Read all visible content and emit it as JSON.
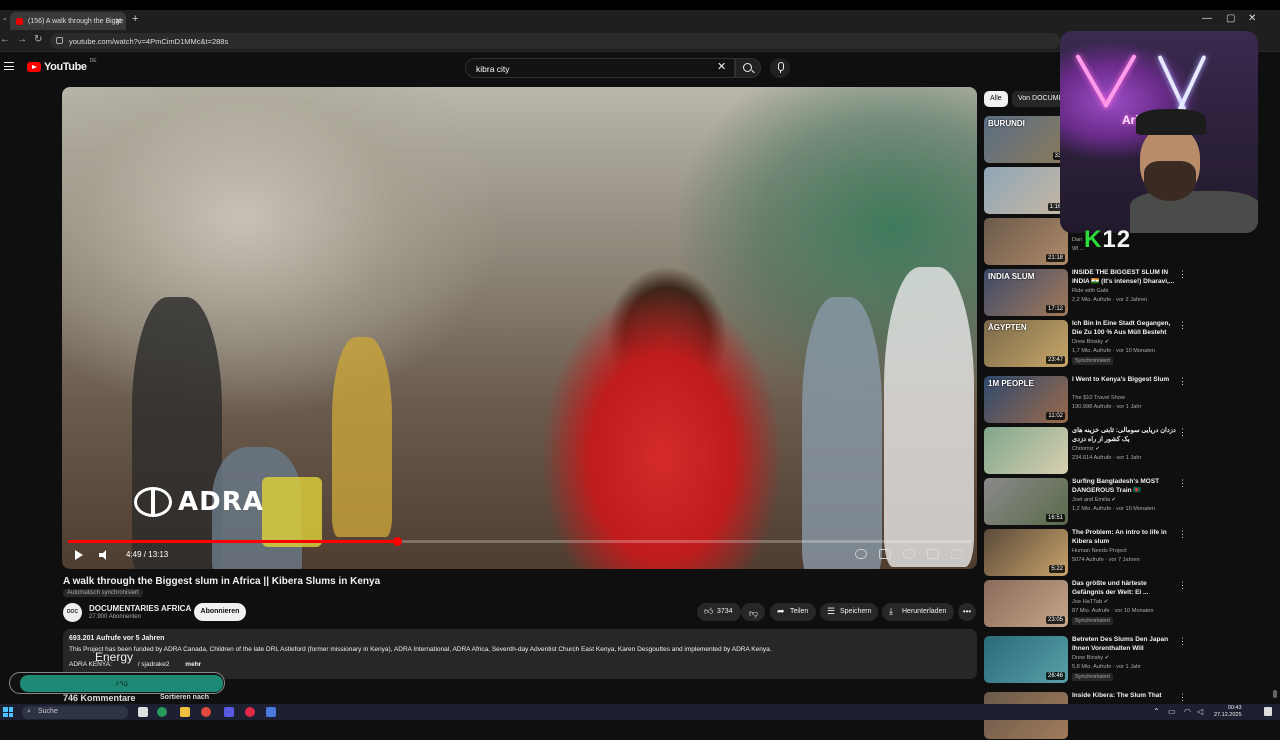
{
  "browser": {
    "tab_title": "(156) A walk through the Bigge",
    "tab_close": "✕",
    "new_tab": "+",
    "url": "youtube.com/watch?v=4PmCimD1MMc&t=288s",
    "window_controls": [
      "—",
      "▢",
      "✕"
    ]
  },
  "header": {
    "logo_text": "YouTube",
    "country_code": "DE",
    "search_value": "kibra city",
    "clear": "✕"
  },
  "player": {
    "overlay_brand": "ADRA",
    "time": "4:49 / 13:13",
    "progress": 0.364
  },
  "video": {
    "title": "A walk through the Biggest slum in Africa || Kibera Slums in Kenya",
    "autosync": "Automatisch synchronisiert",
    "channel_avatar_text": "DOC",
    "channel_name": "DOCUMENTARIES AFRICA",
    "channel_subs": "27.900 Abonnenten",
    "subscribe": "Abonnieren",
    "likes": "3734",
    "share": "Teilen",
    "save": "Speichern",
    "download": "Herunterladen",
    "more": "•••",
    "description": {
      "meta": "693.201 Aufrufe  vor 5 Jahren",
      "body": "This Project has been funded by ADRA Canada, Children of the late DRL Astleford (former missionary in Kenya), ADRA International, ADRA Africa, Seventh-day Adventist Church East Kenya, Karen Desgouttes and implemented by ADRA Kenya.",
      "line3_prefix": "ADRA KENYA:",
      "line3_mid": "/ sjadrake2",
      "line3_more": "mehr"
    },
    "comments": "746 Kommentare",
    "sort": "Sortieren nach"
  },
  "overlay": {
    "energy_label": "Energy",
    "energy_value": "۶۹۵",
    "energy_level": 0.95
  },
  "sidebar": {
    "chips": [
      "Alle",
      "Von DOCUMI"
    ],
    "items": [
      {
        "title": "",
        "channel": "",
        "views": "",
        "duration": "33:",
        "thumb_text": "BURUNDI",
        "colors": [
          "#5b6f86",
          "#8a7a5a"
        ]
      },
      {
        "title": "",
        "channel": "",
        "views": "",
        "duration": "1:16:",
        "thumb_text": "",
        "colors": [
          "#8fa6b8",
          "#c7b7a2"
        ]
      },
      {
        "title": "Mei ... ..u (es ist extrem)",
        "channel": "Dan",
        "views": "98 ...",
        "duration": "21:18",
        "thumb_text": "",
        "colors": [
          "#6a5a4a",
          "#b08a6a"
        ]
      },
      {
        "title": "INSIDE THE BIGGEST SLUM IN INDIA 🇮🇳 (It's intense!) Dharavi,...",
        "channel": "Ride with Gabi",
        "views": "2,2 Mio. Aufrufe · vor 2 Jahren",
        "duration": "17:12",
        "thumb_text": "INDIA SLUM",
        "colors": [
          "#3d4a6a",
          "#a27a5a"
        ]
      },
      {
        "title": "Ich Bin In Eine Stadt Gegangen, Die Zu 100 % Aus Müll Besteht",
        "channel": "Drew Binsky ✔",
        "views": "1,7 Mio. Aufrufe · vor 10 Monaten",
        "duration": "23:47",
        "thumb_text": "ÄGYPTEN",
        "sync": "Synchronisiert",
        "colors": [
          "#7a6a4a",
          "#c8a668"
        ]
      },
      {
        "title": "I Went to Kenya's Biggest Slum",
        "channel": "The $10 Travel Show",
        "views": "190.998 Aufrufe · vor 1 Jahr",
        "duration": "11:02",
        "thumb_text": "1M PEOPLE",
        "colors": [
          "#2f4a6f",
          "#9a6a4a"
        ]
      },
      {
        "title": "دزدان دریایی سومالی: ثابتی خزینه های یک کشور از راه دزدی",
        "channel": "Chitomiz ✔",
        "views": "234.614 Aufrufe · vor 1 Jahr",
        "duration": "",
        "thumb_text": "",
        "colors": [
          "#7fa58a",
          "#d8d0b0"
        ]
      },
      {
        "title": "Surfing Bangladesh's MOST DANGEROUS Train 🇧🇩",
        "channel": "Joel and Emilia ✔",
        "views": "1,2 Mio. Aufrufe · vor 10 Monaten",
        "duration": "16:51",
        "thumb_text": "",
        "colors": [
          "#8a8a8a",
          "#5a6a4a"
        ]
      },
      {
        "title": "The Problem:  An intro to life in Kibera slum",
        "channel": "Human Needs Project",
        "views": "5074 Aufrufe · vor 7 Jahren",
        "duration": "5:22",
        "thumb_text": "",
        "colors": [
          "#5a4a3a",
          "#c8a26a"
        ]
      },
      {
        "title": "Das größte und härteste Gefängnis der Welt: El ...",
        "channel": "Joe HaTTab ✔",
        "views": "87 Mio. Aufrufe · vor 10 Monaten",
        "duration": "23:05",
        "thumb_text": "",
        "sync": "Synchronisiert",
        "colors": [
          "#8a6a5a",
          "#c8a68a"
        ]
      },
      {
        "title": "Betreten Des Slums Den Japan Ihnen Vorenthalten Will",
        "channel": "Drew Binsky ✔",
        "views": "5,8 Mio. Aufrufe · vor 1 Jahr",
        "duration": "26:46",
        "thumb_text": "",
        "sync": "Synchronisiert",
        "colors": [
          "#2a6a7a",
          "#5aa0a8"
        ]
      },
      {
        "title": "Inside Kibera: The Slum That",
        "channel": "",
        "views": "",
        "duration": "",
        "thumb_text": "",
        "colors": [
          "#6a5a4a",
          "#a07a5a"
        ]
      }
    ]
  },
  "webcam": {
    "sign_text": "Ari",
    "brand_k": "K",
    "brand_num": "12"
  },
  "taskbar": {
    "search": "Suche",
    "time": "00:43",
    "date": "27.12.2025"
  }
}
